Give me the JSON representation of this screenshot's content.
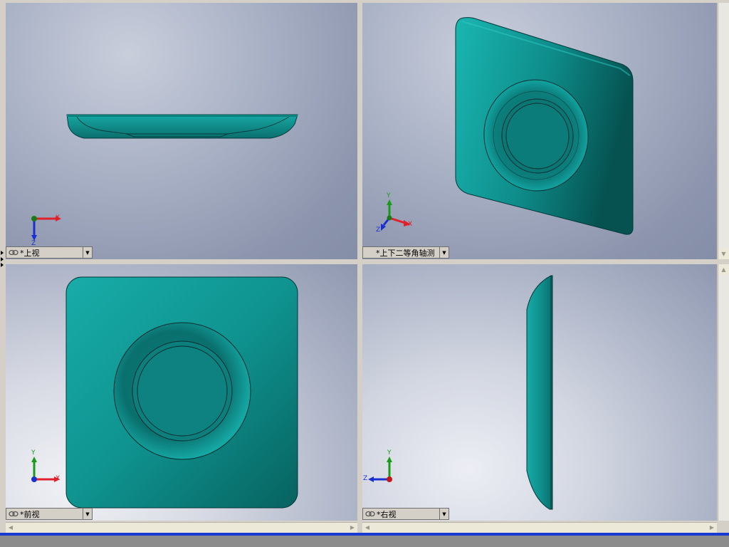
{
  "viewports": {
    "top_left": {
      "view_label": "*上视",
      "axes": [
        "X",
        "Z"
      ]
    },
    "top_right": {
      "view_label": "*上下二等角轴测",
      "axes": [
        "Y",
        "X",
        "Z"
      ]
    },
    "bottom_left": {
      "view_label": "*前视",
      "axes": [
        "Y",
        "X"
      ]
    },
    "bottom_right": {
      "view_label": "*右视",
      "axes": [
        "Y",
        "Z"
      ]
    }
  },
  "icons": {
    "link": "link-icon",
    "dropdown": "chevron-down-icon",
    "scroll_up": "arrow-up-icon",
    "scroll_down": "arrow-down-icon",
    "scroll_left": "arrow-left-icon",
    "scroll_right": "arrow-right-icon"
  },
  "colors": {
    "model": "#0e8c8a",
    "model_dark": "#065a5a",
    "axis_x": "#e0202a",
    "axis_y": "#1a9a1a",
    "axis_z": "#1a2fd0",
    "status_bar": "#1a3bd1"
  }
}
